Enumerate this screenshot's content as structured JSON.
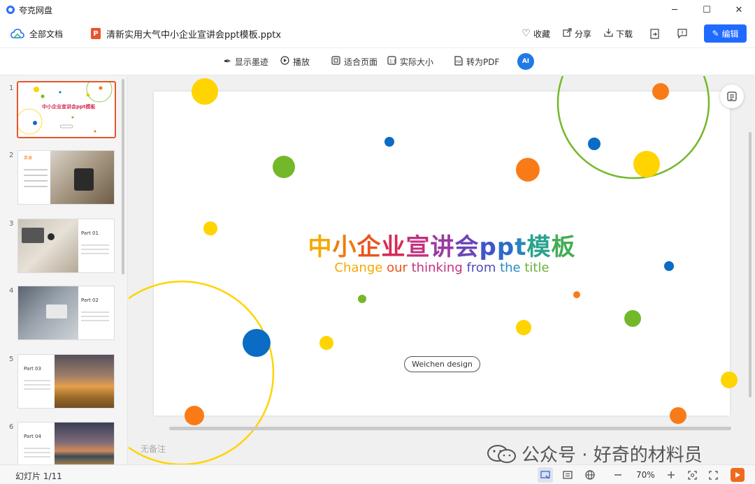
{
  "window": {
    "app_name": "夸克网盘",
    "controls": [
      "─",
      "☐",
      "✕"
    ]
  },
  "docbar": {
    "all_docs": "全部文档",
    "file_icon": "P",
    "file_name": "清新实用大气中小企业宣讲会ppt模板.pptx",
    "collect": "收藏",
    "share": "分享",
    "download": "下载",
    "edit": "编辑"
  },
  "toolbar": {
    "show_ink": "显示墨迹",
    "play": "播放",
    "fit_page": "适合页面",
    "actual_size": "实际大小",
    "to_pdf": "转为PDF",
    "ai": "AI"
  },
  "thumbnails": {
    "numbers": [
      "1",
      "2",
      "3",
      "4",
      "5",
      "6"
    ],
    "t1_title": "中小企业宣讲会ppt模板",
    "t2_heading": "目录",
    "t3_part": "Part 01",
    "t4_part": "Part 02",
    "t5_part": "Part 03",
    "t6_part": "Part 04"
  },
  "slide": {
    "title_chars": [
      {
        "t": "中",
        "c": "#f5a800"
      },
      {
        "t": "小",
        "c": "#f07a10"
      },
      {
        "t": "企",
        "c": "#e8551f"
      },
      {
        "t": "业",
        "c": "#d82a55"
      },
      {
        "t": "宣",
        "c": "#c3307f"
      },
      {
        "t": "讲",
        "c": "#9a3aa0"
      },
      {
        "t": "会",
        "c": "#6b45b8"
      },
      {
        "t": "p",
        "c": "#3f55c8"
      },
      {
        "t": "p",
        "c": "#2d6ac9"
      },
      {
        "t": "t",
        "c": "#2785c0"
      },
      {
        "t": "模",
        "c": "#2aa28f"
      },
      {
        "t": "板",
        "c": "#44ad55"
      }
    ],
    "subtitle_parts": [
      {
        "t": "Change ",
        "c": "#f5a800"
      },
      {
        "t": "our ",
        "c": "#e8551f"
      },
      {
        "t": "thinking ",
        "c": "#c3307f"
      },
      {
        "t": "from ",
        "c": "#4f4cc0"
      },
      {
        "t": "the ",
        "c": "#2a8ac4"
      },
      {
        "t": "title",
        "c": "#6ab23c"
      }
    ],
    "button": "Weichen design"
  },
  "notes_placeholder": "无备注",
  "watermark": "公众号 · 好奇的材料员",
  "statusbar": {
    "slide_count": "幻灯片 1/11",
    "zoom": "70%"
  },
  "colors": {
    "accent": "#1f6bff",
    "yellow": "#ffd400",
    "orange": "#f97b17",
    "green": "#73b82a",
    "blue": "#0a6cc4"
  }
}
